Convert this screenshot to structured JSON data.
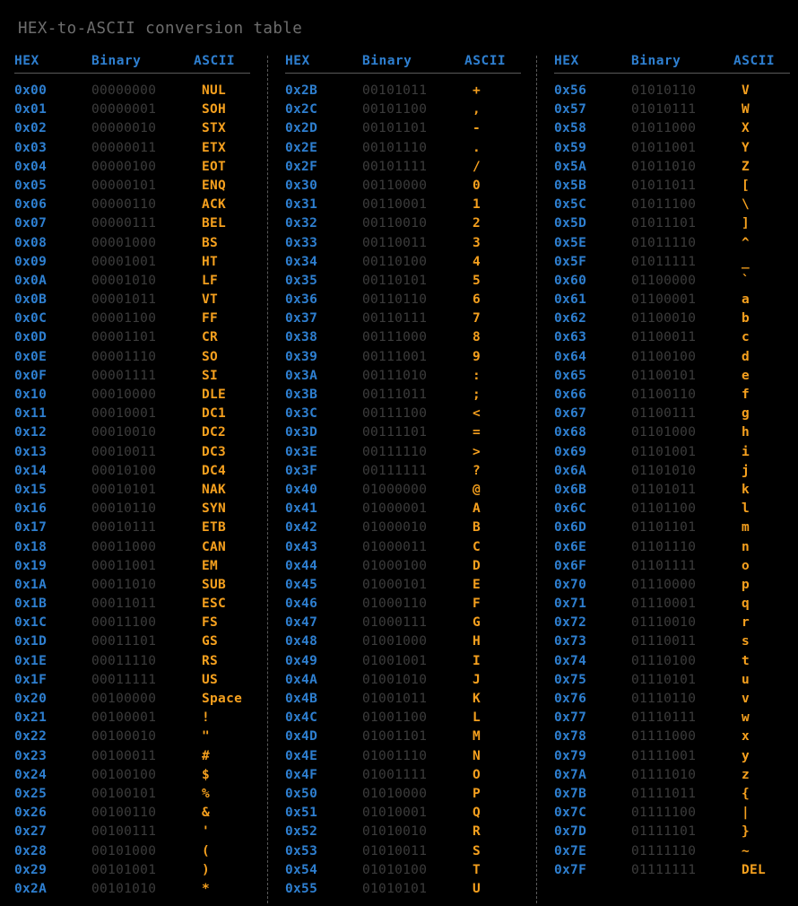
{
  "title": "HEX-to-ASCII conversion table",
  "colors": {
    "background": "#000000",
    "title": "#6d6d6d",
    "hex": "#2e7fd0",
    "header": "#2e7fd0",
    "binary": "#3c3c3c",
    "ascii": "#f5a01e",
    "rule": "#5a5a5a"
  },
  "headers": {
    "hex": "HEX",
    "binary": "Binary",
    "ascii": "ASCII"
  },
  "columns": [
    {
      "rows": [
        {
          "hex": "0x00",
          "binary": "00000000",
          "ascii": "NUL"
        },
        {
          "hex": "0x01",
          "binary": "00000001",
          "ascii": "SOH"
        },
        {
          "hex": "0x02",
          "binary": "00000010",
          "ascii": "STX"
        },
        {
          "hex": "0x03",
          "binary": "00000011",
          "ascii": "ETX"
        },
        {
          "hex": "0x04",
          "binary": "00000100",
          "ascii": "EOT"
        },
        {
          "hex": "0x05",
          "binary": "00000101",
          "ascii": "ENQ"
        },
        {
          "hex": "0x06",
          "binary": "00000110",
          "ascii": "ACK"
        },
        {
          "hex": "0x07",
          "binary": "00000111",
          "ascii": "BEL"
        },
        {
          "hex": "0x08",
          "binary": "00001000",
          "ascii": "BS"
        },
        {
          "hex": "0x09",
          "binary": "00001001",
          "ascii": "HT"
        },
        {
          "hex": "0x0A",
          "binary": "00001010",
          "ascii": "LF"
        },
        {
          "hex": "0x0B",
          "binary": "00001011",
          "ascii": "VT"
        },
        {
          "hex": "0x0C",
          "binary": "00001100",
          "ascii": "FF"
        },
        {
          "hex": "0x0D",
          "binary": "00001101",
          "ascii": "CR"
        },
        {
          "hex": "0x0E",
          "binary": "00001110",
          "ascii": "SO"
        },
        {
          "hex": "0x0F",
          "binary": "00001111",
          "ascii": "SI"
        },
        {
          "hex": "0x10",
          "binary": "00010000",
          "ascii": "DLE"
        },
        {
          "hex": "0x11",
          "binary": "00010001",
          "ascii": "DC1"
        },
        {
          "hex": "0x12",
          "binary": "00010010",
          "ascii": "DC2"
        },
        {
          "hex": "0x13",
          "binary": "00010011",
          "ascii": "DC3"
        },
        {
          "hex": "0x14",
          "binary": "00010100",
          "ascii": "DC4"
        },
        {
          "hex": "0x15",
          "binary": "00010101",
          "ascii": "NAK"
        },
        {
          "hex": "0x16",
          "binary": "00010110",
          "ascii": "SYN"
        },
        {
          "hex": "0x17",
          "binary": "00010111",
          "ascii": "ETB"
        },
        {
          "hex": "0x18",
          "binary": "00011000",
          "ascii": "CAN"
        },
        {
          "hex": "0x19",
          "binary": "00011001",
          "ascii": "EM"
        },
        {
          "hex": "0x1A",
          "binary": "00011010",
          "ascii": "SUB"
        },
        {
          "hex": "0x1B",
          "binary": "00011011",
          "ascii": "ESC"
        },
        {
          "hex": "0x1C",
          "binary": "00011100",
          "ascii": "FS"
        },
        {
          "hex": "0x1D",
          "binary": "00011101",
          "ascii": "GS"
        },
        {
          "hex": "0x1E",
          "binary": "00011110",
          "ascii": "RS"
        },
        {
          "hex": "0x1F",
          "binary": "00011111",
          "ascii": "US"
        },
        {
          "hex": "0x20",
          "binary": "00100000",
          "ascii": "Space"
        },
        {
          "hex": "0x21",
          "binary": "00100001",
          "ascii": "!"
        },
        {
          "hex": "0x22",
          "binary": "00100010",
          "ascii": "\""
        },
        {
          "hex": "0x23",
          "binary": "00100011",
          "ascii": "#"
        },
        {
          "hex": "0x24",
          "binary": "00100100",
          "ascii": "$"
        },
        {
          "hex": "0x25",
          "binary": "00100101",
          "ascii": "%"
        },
        {
          "hex": "0x26",
          "binary": "00100110",
          "ascii": "&"
        },
        {
          "hex": "0x27",
          "binary": "00100111",
          "ascii": "'"
        },
        {
          "hex": "0x28",
          "binary": "00101000",
          "ascii": "("
        },
        {
          "hex": "0x29",
          "binary": "00101001",
          "ascii": ")"
        },
        {
          "hex": "0x2A",
          "binary": "00101010",
          "ascii": "*"
        }
      ]
    },
    {
      "rows": [
        {
          "hex": "0x2B",
          "binary": "00101011",
          "ascii": "+"
        },
        {
          "hex": "0x2C",
          "binary": "00101100",
          "ascii": ","
        },
        {
          "hex": "0x2D",
          "binary": "00101101",
          "ascii": "-"
        },
        {
          "hex": "0x2E",
          "binary": "00101110",
          "ascii": "."
        },
        {
          "hex": "0x2F",
          "binary": "00101111",
          "ascii": "/"
        },
        {
          "hex": "0x30",
          "binary": "00110000",
          "ascii": "0"
        },
        {
          "hex": "0x31",
          "binary": "00110001",
          "ascii": "1"
        },
        {
          "hex": "0x32",
          "binary": "00110010",
          "ascii": "2"
        },
        {
          "hex": "0x33",
          "binary": "00110011",
          "ascii": "3"
        },
        {
          "hex": "0x34",
          "binary": "00110100",
          "ascii": "4"
        },
        {
          "hex": "0x35",
          "binary": "00110101",
          "ascii": "5"
        },
        {
          "hex": "0x36",
          "binary": "00110110",
          "ascii": "6"
        },
        {
          "hex": "0x37",
          "binary": "00110111",
          "ascii": "7"
        },
        {
          "hex": "0x38",
          "binary": "00111000",
          "ascii": "8"
        },
        {
          "hex": "0x39",
          "binary": "00111001",
          "ascii": "9"
        },
        {
          "hex": "0x3A",
          "binary": "00111010",
          "ascii": ":"
        },
        {
          "hex": "0x3B",
          "binary": "00111011",
          "ascii": ";"
        },
        {
          "hex": "0x3C",
          "binary": "00111100",
          "ascii": "<"
        },
        {
          "hex": "0x3D",
          "binary": "00111101",
          "ascii": "="
        },
        {
          "hex": "0x3E",
          "binary": "00111110",
          "ascii": ">"
        },
        {
          "hex": "0x3F",
          "binary": "00111111",
          "ascii": "?"
        },
        {
          "hex": "0x40",
          "binary": "01000000",
          "ascii": "@"
        },
        {
          "hex": "0x41",
          "binary": "01000001",
          "ascii": "A"
        },
        {
          "hex": "0x42",
          "binary": "01000010",
          "ascii": "B"
        },
        {
          "hex": "0x43",
          "binary": "01000011",
          "ascii": "C"
        },
        {
          "hex": "0x44",
          "binary": "01000100",
          "ascii": "D"
        },
        {
          "hex": "0x45",
          "binary": "01000101",
          "ascii": "E"
        },
        {
          "hex": "0x46",
          "binary": "01000110",
          "ascii": "F"
        },
        {
          "hex": "0x47",
          "binary": "01000111",
          "ascii": "G"
        },
        {
          "hex": "0x48",
          "binary": "01001000",
          "ascii": "H"
        },
        {
          "hex": "0x49",
          "binary": "01001001",
          "ascii": "I"
        },
        {
          "hex": "0x4A",
          "binary": "01001010",
          "ascii": "J"
        },
        {
          "hex": "0x4B",
          "binary": "01001011",
          "ascii": "K"
        },
        {
          "hex": "0x4C",
          "binary": "01001100",
          "ascii": "L"
        },
        {
          "hex": "0x4D",
          "binary": "01001101",
          "ascii": "M"
        },
        {
          "hex": "0x4E",
          "binary": "01001110",
          "ascii": "N"
        },
        {
          "hex": "0x4F",
          "binary": "01001111",
          "ascii": "O"
        },
        {
          "hex": "0x50",
          "binary": "01010000",
          "ascii": "P"
        },
        {
          "hex": "0x51",
          "binary": "01010001",
          "ascii": "Q"
        },
        {
          "hex": "0x52",
          "binary": "01010010",
          "ascii": "R"
        },
        {
          "hex": "0x53",
          "binary": "01010011",
          "ascii": "S"
        },
        {
          "hex": "0x54",
          "binary": "01010100",
          "ascii": "T"
        },
        {
          "hex": "0x55",
          "binary": "01010101",
          "ascii": "U"
        }
      ]
    },
    {
      "rows": [
        {
          "hex": "0x56",
          "binary": "01010110",
          "ascii": "V"
        },
        {
          "hex": "0x57",
          "binary": "01010111",
          "ascii": "W"
        },
        {
          "hex": "0x58",
          "binary": "01011000",
          "ascii": "X"
        },
        {
          "hex": "0x59",
          "binary": "01011001",
          "ascii": "Y"
        },
        {
          "hex": "0x5A",
          "binary": "01011010",
          "ascii": "Z"
        },
        {
          "hex": "0x5B",
          "binary": "01011011",
          "ascii": "["
        },
        {
          "hex": "0x5C",
          "binary": "01011100",
          "ascii": "\\"
        },
        {
          "hex": "0x5D",
          "binary": "01011101",
          "ascii": "]"
        },
        {
          "hex": "0x5E",
          "binary": "01011110",
          "ascii": "^"
        },
        {
          "hex": "0x5F",
          "binary": "01011111",
          "ascii": "_"
        },
        {
          "hex": "0x60",
          "binary": "01100000",
          "ascii": "`"
        },
        {
          "hex": "0x61",
          "binary": "01100001",
          "ascii": "a"
        },
        {
          "hex": "0x62",
          "binary": "01100010",
          "ascii": "b"
        },
        {
          "hex": "0x63",
          "binary": "01100011",
          "ascii": "c"
        },
        {
          "hex": "0x64",
          "binary": "01100100",
          "ascii": "d"
        },
        {
          "hex": "0x65",
          "binary": "01100101",
          "ascii": "e"
        },
        {
          "hex": "0x66",
          "binary": "01100110",
          "ascii": "f"
        },
        {
          "hex": "0x67",
          "binary": "01100111",
          "ascii": "g"
        },
        {
          "hex": "0x68",
          "binary": "01101000",
          "ascii": "h"
        },
        {
          "hex": "0x69",
          "binary": "01101001",
          "ascii": "i"
        },
        {
          "hex": "0x6A",
          "binary": "01101010",
          "ascii": "j"
        },
        {
          "hex": "0x6B",
          "binary": "01101011",
          "ascii": "k"
        },
        {
          "hex": "0x6C",
          "binary": "01101100",
          "ascii": "l"
        },
        {
          "hex": "0x6D",
          "binary": "01101101",
          "ascii": "m"
        },
        {
          "hex": "0x6E",
          "binary": "01101110",
          "ascii": "n"
        },
        {
          "hex": "0x6F",
          "binary": "01101111",
          "ascii": "o"
        },
        {
          "hex": "0x70",
          "binary": "01110000",
          "ascii": "p"
        },
        {
          "hex": "0x71",
          "binary": "01110001",
          "ascii": "q"
        },
        {
          "hex": "0x72",
          "binary": "01110010",
          "ascii": "r"
        },
        {
          "hex": "0x73",
          "binary": "01110011",
          "ascii": "s"
        },
        {
          "hex": "0x74",
          "binary": "01110100",
          "ascii": "t"
        },
        {
          "hex": "0x75",
          "binary": "01110101",
          "ascii": "u"
        },
        {
          "hex": "0x76",
          "binary": "01110110",
          "ascii": "v"
        },
        {
          "hex": "0x77",
          "binary": "01110111",
          "ascii": "w"
        },
        {
          "hex": "0x78",
          "binary": "01111000",
          "ascii": "x"
        },
        {
          "hex": "0x79",
          "binary": "01111001",
          "ascii": "y"
        },
        {
          "hex": "0x7A",
          "binary": "01111010",
          "ascii": "z"
        },
        {
          "hex": "0x7B",
          "binary": "01111011",
          "ascii": "{"
        },
        {
          "hex": "0x7C",
          "binary": "01111100",
          "ascii": "|"
        },
        {
          "hex": "0x7D",
          "binary": "01111101",
          "ascii": "}"
        },
        {
          "hex": "0x7E",
          "binary": "01111110",
          "ascii": "~"
        },
        {
          "hex": "0x7F",
          "binary": "01111111",
          "ascii": "DEL"
        }
      ]
    }
  ]
}
